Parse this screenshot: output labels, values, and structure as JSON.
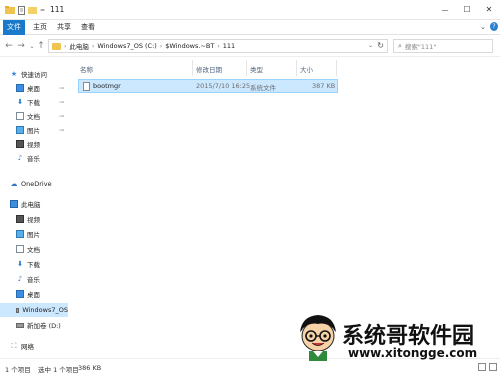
{
  "window": {
    "title": "111",
    "controls": {
      "minimize": "—",
      "maximize": "☐",
      "close": "✕"
    }
  },
  "quick_access_toolbar": {
    "dropdown": "="
  },
  "ribbon": {
    "tabs": [
      {
        "label": "文件"
      },
      {
        "label": "主页"
      },
      {
        "label": "共享"
      },
      {
        "label": "查看"
      }
    ],
    "file_tab_color": "#1979ca"
  },
  "address_bar": {
    "crumbs": [
      "此电脑",
      "Windows7_OS (C:)",
      "$Windows.~BT",
      "111"
    ],
    "separator": "›"
  },
  "search": {
    "placeholder": "搜索\"111\""
  },
  "nav_pane": {
    "items": [
      {
        "label": "快速访问",
        "icon": "star-icon"
      },
      {
        "label": "桌面",
        "icon": "desktop-icon",
        "pinned": true
      },
      {
        "label": "下载",
        "icon": "download-icon",
        "pinned": true
      },
      {
        "label": "文档",
        "icon": "document-icon",
        "pinned": true
      },
      {
        "label": "图片",
        "icon": "picture-icon",
        "pinned": true
      },
      {
        "label": "视频",
        "icon": "video-icon"
      },
      {
        "label": "音乐",
        "icon": "music-icon"
      },
      {
        "label": "OneDrive",
        "icon": "cloud-icon"
      },
      {
        "label": "此电脑",
        "icon": "pc-icon"
      },
      {
        "label": "视频",
        "icon": "video-icon"
      },
      {
        "label": "图片",
        "icon": "picture-icon"
      },
      {
        "label": "文档",
        "icon": "document-icon"
      },
      {
        "label": "下载",
        "icon": "download-icon"
      },
      {
        "label": "音乐",
        "icon": "music-icon"
      },
      {
        "label": "桌面",
        "icon": "desktop-icon"
      },
      {
        "label": "Windows7_OS",
        "icon": "drive-icon",
        "selected": true
      },
      {
        "label": "新加卷 (D:)",
        "icon": "drive-icon"
      },
      {
        "label": "网络",
        "icon": "network-icon"
      }
    ]
  },
  "columns": [
    "名称",
    "修改日期",
    "类型",
    "大小"
  ],
  "files": [
    {
      "name": "bootmgr",
      "modified": "2015/7/10 16:25",
      "type": "系统文件",
      "size": "387 KB"
    }
  ],
  "status": {
    "count": "1 个项目",
    "selected": "选中 1 个项目",
    "size": "386 KB"
  },
  "watermark": {
    "title": "系统哥软件园",
    "url": "www.xitongge.com"
  },
  "accent_color": "#1979ca",
  "selection_color": "#cce8ff"
}
